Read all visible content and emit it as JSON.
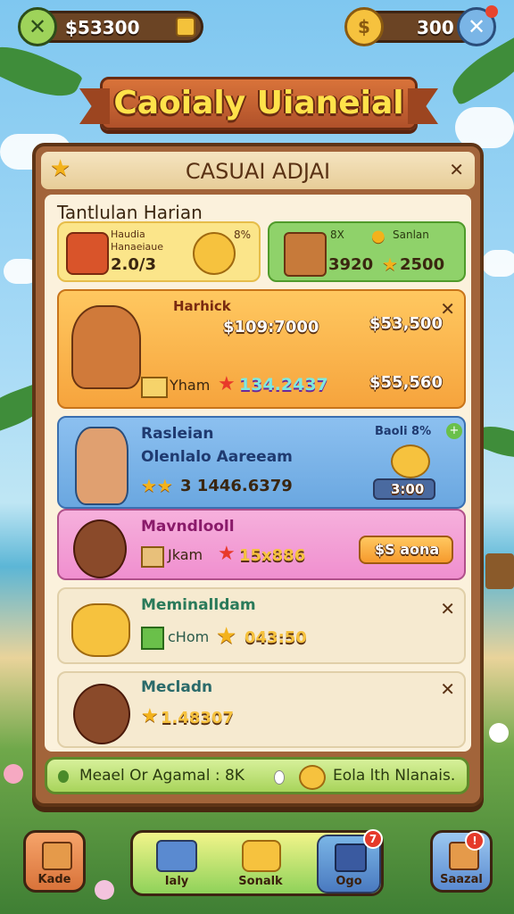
{
  "topbar": {
    "cash_value": "$53300",
    "coins_value": "300"
  },
  "banner": {
    "title": "Caoialy Uianeial"
  },
  "panel": {
    "title": "CASUAI ADJAI",
    "subtitle": "Tantlulan Harian",
    "summary_left": {
      "label_a": "Haudia",
      "label_b": "Hanaeiaue",
      "value": "2.0/3",
      "pct": "8%"
    },
    "summary_right": {
      "label_a": "8X",
      "label_b": "Sanlan",
      "value_a": "3920",
      "value_b": "2500"
    },
    "quests": [
      {
        "title": "Harhick",
        "amount_top": "$109:7000",
        "reward_top": "$53,500",
        "item_label": "Yham",
        "score": "134.2437",
        "reward_bottom": "$55,560"
      },
      {
        "title": "Rasleian",
        "subtitle": "Olenlalo Aareeam",
        "score": "3 1446.6379",
        "corner_label": "Baoli 8%",
        "reward": "3:00"
      },
      {
        "title": "Mavndlooll",
        "item_label": "Jkam",
        "score": "15x886",
        "button_label": "$S aona"
      },
      {
        "title": "Meminalldam",
        "item_label": "cHom",
        "score": "043:50"
      },
      {
        "title": "Mecladn",
        "score": "1.48307"
      }
    ],
    "footer_left": "Meael Or Agamal  :  8K",
    "footer_right": "Eola lth Nlanais."
  },
  "nav": [
    {
      "label": "Kade"
    },
    {
      "label": "Ialy"
    },
    {
      "label": "Sonalk"
    },
    {
      "label": "Ogo",
      "badge": "7"
    },
    {
      "label": "Saazal",
      "badge": "!"
    }
  ],
  "colors": {
    "panel_wood": "#a2643a",
    "quest_orange": "#f6a43d",
    "quest_blue": "#6aa7e0",
    "quest_pink": "#f08fcf",
    "accent_green": "#7cc34a"
  }
}
